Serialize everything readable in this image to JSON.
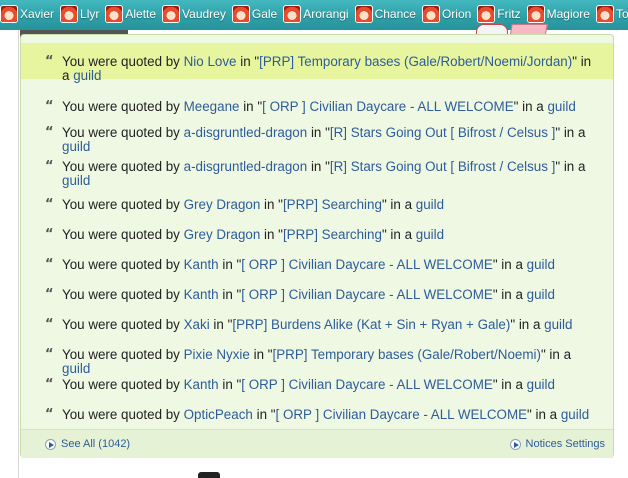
{
  "topbar": {
    "friends": [
      "Xavier",
      "Llyr",
      "Alette",
      "Vaudrey",
      "Gale",
      "Arorangi",
      "Chance",
      "Orion",
      "Fritz",
      "Magiore",
      "Tol"
    ]
  },
  "notices": {
    "prefix": "You were quoted by",
    "in_word": "in",
    "in_a": "in a",
    "guild_word": "guild",
    "items": [
      {
        "user": "Nio Love",
        "thread": "[PRP] Temporary bases (Gale/Robert/Noemi/Jordan)",
        "highlight": true
      },
      {
        "user": "Meegane",
        "thread": "[ ORP ] Civilian Daycare - ALL WELCOME"
      },
      {
        "user": "a-disgruntled-dragon",
        "thread": "[R] Stars Going Out [ Bifrost / Celsus ]"
      },
      {
        "user": "a-disgruntled-dragon",
        "thread": "[R] Stars Going Out [ Bifrost / Celsus ]"
      },
      {
        "user": "Grey Dragon",
        "thread": "[PRP] Searching"
      },
      {
        "user": "Grey Dragon",
        "thread": "[PRP] Searching"
      },
      {
        "user": "Kanth",
        "thread": "[ ORP ] Civilian Daycare - ALL WELCOME"
      },
      {
        "user": "Kanth",
        "thread": "[ ORP ] Civilian Daycare - ALL WELCOME"
      },
      {
        "user": "Xaki",
        "thread": "[PRP] Burdens Alike (Kat + Sin + Ryan + Gale)"
      },
      {
        "user": "Pixie Nyxie",
        "thread": "[PRP] Temporary bases (Gale/Robert/Noemi)"
      },
      {
        "user": "Kanth",
        "thread": "[ ORP ] Civilian Daycare - ALL WELCOME"
      },
      {
        "user": "OpticPeach",
        "thread": "[ ORP ] Civilian Daycare - ALL WELCOME"
      }
    ]
  },
  "footer": {
    "see_all": "See All (1042)",
    "settings": "Notices Settings"
  },
  "colors": {
    "panel_bg": "#eef8e2",
    "highlight_bg": "#e7f59f",
    "link": "#2e5c9a",
    "topbar": "#2e9ea6"
  }
}
